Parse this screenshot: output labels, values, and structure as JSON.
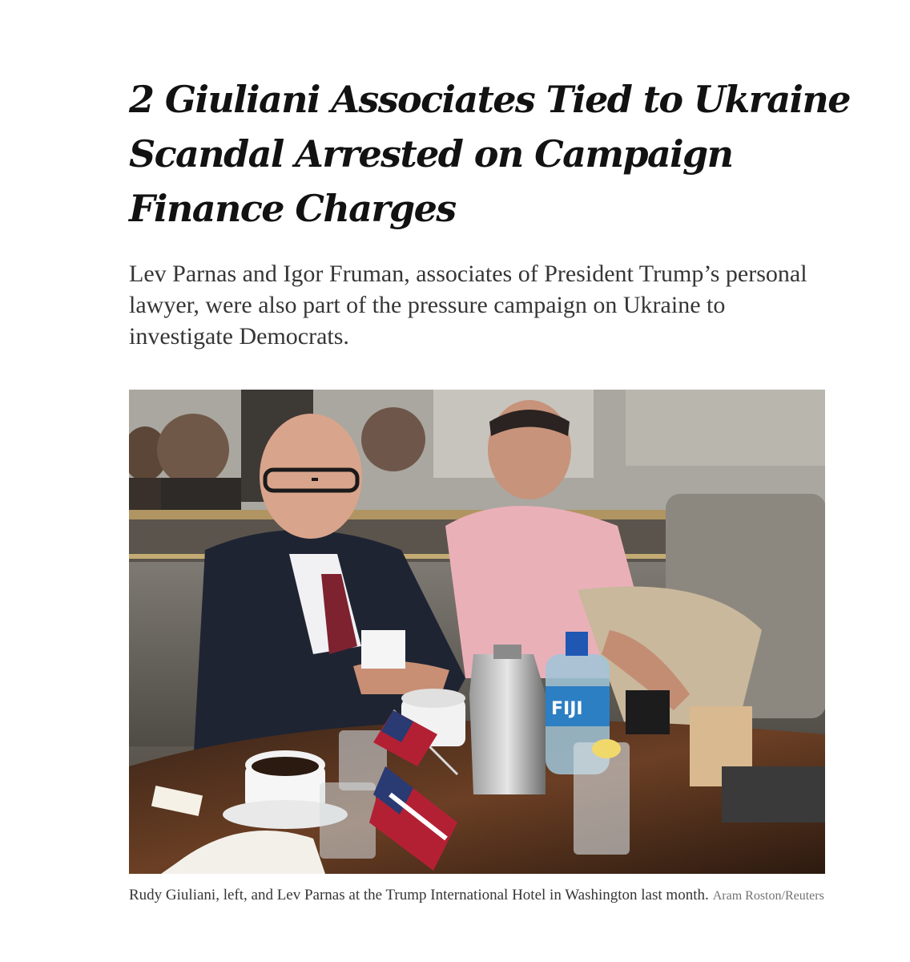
{
  "article": {
    "headline": "2 Giuliani Associates Tied to Ukraine Scandal Arrested on Campaign Finance Charges",
    "summary": "Lev Parnas and Igor Fruman, associates of President Trump’s personal lawyer, were also part of the pressure campaign on Ukraine to investigate Democrats.",
    "photo": {
      "icon": "photo-rudy-giuliani-lev-parnas",
      "bottle_label": "FIJI"
    },
    "caption": "Rudy Giuliani, left, and Lev Parnas at the Trump International Hotel in Washington last month.",
    "credit": "Aram Roston/Reuters"
  }
}
